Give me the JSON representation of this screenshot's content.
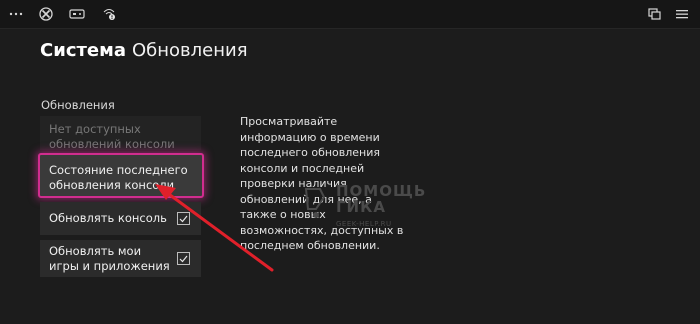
{
  "header": {
    "system": "Система",
    "page": "Обновления"
  },
  "section_label": "Обновления",
  "items": {
    "no_updates": "Нет доступных обновлений консоли",
    "status": "Состояние последнего обновления консоли",
    "update_console": "Обновлять консоль",
    "update_games": "Обновлять мои игры и приложения"
  },
  "description": "Просматривайте информацию о времени последнего обновления консоли и последней проверки наличия обновлений для нее, а также о новых возможностях, доступных в последнем обновлении.",
  "watermark": {
    "line1": "ПОМОЩЬ",
    "line2": "ГИКА",
    "url": "GEEK-HELP.RU"
  },
  "icons": [
    "more-icon",
    "xbox-logo-icon",
    "controller-icon",
    "notifications-icon",
    "snap-view-icon",
    "menu-icon"
  ],
  "colors": {
    "highlight_border": "#d12d8f",
    "arrow": "#e0202a",
    "background": "#1c1c1c"
  },
  "checkboxes": {
    "update_console": true,
    "update_games": true
  }
}
